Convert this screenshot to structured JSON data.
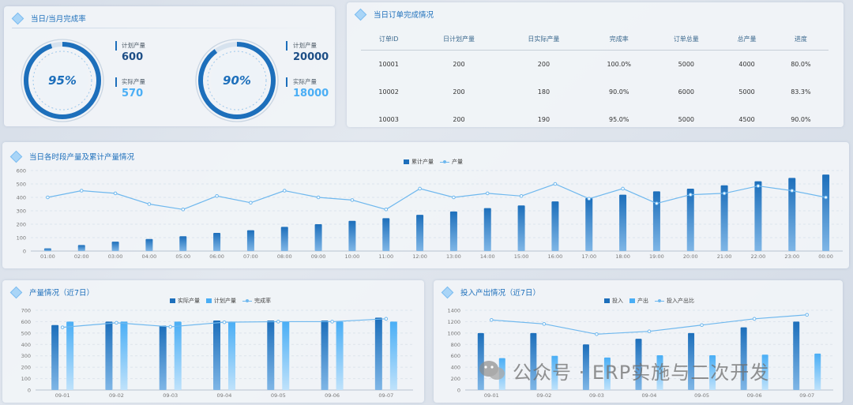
{
  "completion": {
    "title": "当日/当月完成率",
    "gauges": [
      {
        "percent_label": "95%",
        "fraction": 0.95,
        "plan_label": "计划产量",
        "plan_value": "600",
        "actual_label": "实际产量",
        "actual_value": "570"
      },
      {
        "percent_label": "90%",
        "fraction": 0.9,
        "plan_label": "计划产量",
        "plan_value": "20000",
        "actual_label": "实际产量",
        "actual_value": "18000"
      }
    ]
  },
  "orders": {
    "title": "当日订单完成情况",
    "columns": [
      "订单ID",
      "日计划产量",
      "日实际产量",
      "完成率",
      "订单总量",
      "总产量",
      "进度"
    ],
    "rows": [
      [
        "10001",
        "200",
        "200",
        "100.0%",
        "5000",
        "4000",
        "80.0%"
      ],
      [
        "10002",
        "200",
        "180",
        "90.0%",
        "6000",
        "5000",
        "83.3%"
      ],
      [
        "10003",
        "200",
        "190",
        "95.0%",
        "5000",
        "4500",
        "90.0%"
      ]
    ]
  },
  "hourly": {
    "title": "当日各时段产量及累计产量情况",
    "legend": [
      "累计产量",
      "产量"
    ]
  },
  "weekly": {
    "title": "产量情况（近7日）",
    "legend": [
      "实际产量",
      "计划产量",
      "完成率"
    ]
  },
  "io": {
    "title": "投入产出情况（近7日）",
    "legend": [
      "投入",
      "产出",
      "投入产出比"
    ]
  },
  "watermark": {
    "text": "公众号 · ERP实施与二次开发"
  },
  "colors": {
    "dark_bar": "#1d6fbb",
    "light_bar": "#4aaef5",
    "line": "#6fb8ee",
    "title": "#1d6fbb"
  },
  "chart_data": [
    {
      "type": "bar",
      "title": "当日各时段产量及累计产量情况",
      "categories": [
        "01:00",
        "02:00",
        "03:00",
        "04:00",
        "05:00",
        "06:00",
        "07:00",
        "08:00",
        "09:00",
        "10:00",
        "11:00",
        "12:00",
        "13:00",
        "14:00",
        "15:00",
        "16:00",
        "17:00",
        "18:00",
        "19:00",
        "20:00",
        "21:00",
        "22:00",
        "23:00",
        "00:00"
      ],
      "series": [
        {
          "name": "累计产量",
          "kind": "bar",
          "values": [
            20,
            45,
            70,
            90,
            110,
            135,
            155,
            180,
            200,
            225,
            245,
            270,
            295,
            320,
            340,
            370,
            395,
            420,
            445,
            465,
            490,
            520,
            545,
            570
          ]
        },
        {
          "name": "产量",
          "kind": "line",
          "values": [
            400,
            450,
            430,
            350,
            310,
            410,
            360,
            450,
            400,
            380,
            310,
            465,
            400,
            430,
            410,
            500,
            390,
            465,
            355,
            420,
            430,
            485,
            450,
            400
          ]
        }
      ],
      "ylim": [
        0,
        600
      ],
      "yticks": [
        0,
        100,
        200,
        300,
        400,
        500,
        600
      ],
      "legend_position": "top-center",
      "grid": true
    },
    {
      "type": "bar",
      "title": "产量情况（近7日）",
      "categories": [
        "09-01",
        "09-02",
        "09-03",
        "09-04",
        "09-05",
        "09-06",
        "09-07"
      ],
      "series": [
        {
          "name": "实际产量",
          "kind": "bar",
          "values": [
            570,
            600,
            565,
            610,
            610,
            610,
            635
          ]
        },
        {
          "name": "计划产量",
          "kind": "bar",
          "values": [
            600,
            600,
            600,
            600,
            600,
            600,
            600
          ]
        },
        {
          "name": "完成率",
          "kind": "line",
          "values": [
            550,
            590,
            555,
            595,
            600,
            600,
            625
          ]
        }
      ],
      "ylim": [
        0,
        700
      ],
      "yticks": [
        0,
        100,
        200,
        300,
        400,
        500,
        600,
        700
      ],
      "legend_position": "top-center",
      "grid": true
    },
    {
      "type": "bar",
      "title": "投入产出情况（近7日）",
      "categories": [
        "09-01",
        "09-02",
        "09-03",
        "09-04",
        "09-05",
        "09-06",
        "09-07"
      ],
      "series": [
        {
          "name": "投入",
          "kind": "bar",
          "values": [
            1000,
            1000,
            800,
            900,
            1000,
            1100,
            1200
          ]
        },
        {
          "name": "产出",
          "kind": "bar",
          "values": [
            560,
            600,
            570,
            610,
            610,
            620,
            640
          ]
        },
        {
          "name": "投入产出比",
          "kind": "line",
          "values": [
            1230,
            1160,
            980,
            1030,
            1140,
            1250,
            1320
          ]
        }
      ],
      "ylim": [
        0,
        1400
      ],
      "yticks": [
        0,
        200,
        400,
        600,
        800,
        1000,
        1200,
        1400
      ],
      "legend_position": "top-center",
      "grid": true
    }
  ]
}
